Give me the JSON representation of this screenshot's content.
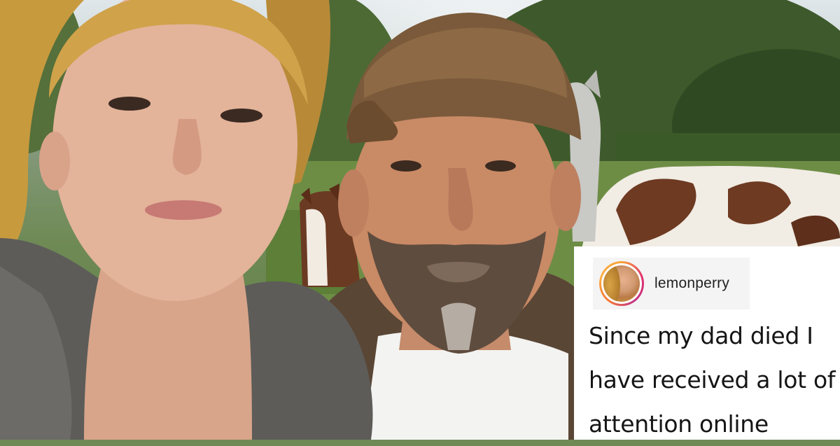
{
  "post": {
    "username": "lemonperry",
    "caption_lines": [
      "Since my dad died I",
      "have received a lot of",
      "attention online"
    ]
  },
  "colors": {
    "caption_background": "#ffffff",
    "user_chip_background": "#f4f4f4",
    "text": "#151515",
    "avatar_ring": "#e1306c"
  },
  "icons": {
    "avatar": "profile-photo-avatar"
  }
}
